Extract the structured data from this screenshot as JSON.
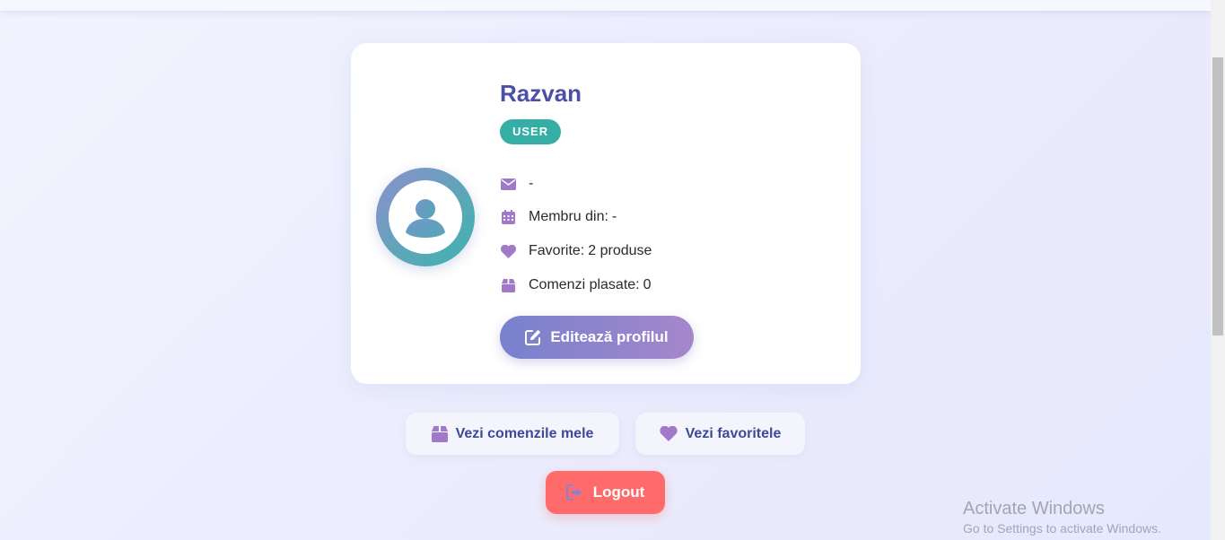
{
  "profile": {
    "name": "Razvan",
    "role": "USER",
    "email": "-",
    "member_since_label": "Membru din:",
    "member_since_value": "-",
    "favorites_label": "Favorite:",
    "favorites_value": "2 produse",
    "orders_label": "Comenzi plasate:",
    "orders_value": "0"
  },
  "actions": {
    "edit_profile": "Editează profilul",
    "view_orders": "Vezi comenzile mele",
    "view_favorites": "Vezi favoritele",
    "logout": "Logout"
  },
  "icons": {
    "avatar": "user-circle-icon",
    "email": "envelope-icon",
    "member_since": "calendar-icon",
    "favorites": "heart-icon",
    "orders": "box-icon",
    "edit": "edit-icon",
    "logout": "sign-out-icon"
  },
  "colors": {
    "name": "#4a4fa8",
    "role_badge": "#35aea6",
    "icon_accent": "#a278c9",
    "edit_button_start": "#7782cd",
    "edit_button_end": "#a586cb",
    "logout_button": "#ff6b6b",
    "secondary_text": "#3f4797"
  },
  "watermark": {
    "title": "Activate Windows",
    "subtitle": "Go to Settings to activate Windows."
  }
}
